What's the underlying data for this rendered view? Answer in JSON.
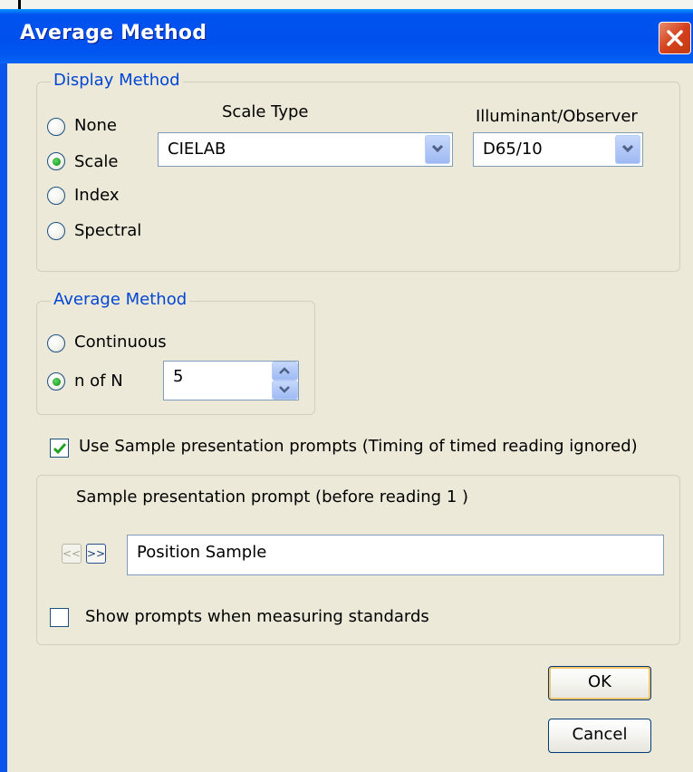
{
  "window": {
    "title": "Average Method"
  },
  "display_method": {
    "legend": "Display Method",
    "options": [
      {
        "label": "None",
        "selected": false
      },
      {
        "label": "Scale",
        "selected": true
      },
      {
        "label": "Index",
        "selected": false
      },
      {
        "label": "Spectral",
        "selected": false
      }
    ],
    "scale_type_label": "Scale Type",
    "scale_type_value": "CIELAB",
    "illuminant_label": "Illuminant/Observer",
    "illuminant_value": "D65/10"
  },
  "average_method": {
    "legend": "Average Method",
    "options": [
      {
        "label": "Continuous",
        "selected": false
      },
      {
        "label": "n of N",
        "selected": true
      }
    ],
    "n_value": "5"
  },
  "prompts": {
    "use_prompts_label": "Use Sample presentation prompts (Timing of timed reading ignored)",
    "use_prompts_checked": true,
    "prompt_caption": "Sample presentation prompt (before reading 1 )",
    "prev_label": "<<",
    "next_label": ">>",
    "prompt_value": "Position Sample",
    "show_standards_label": "Show prompts when measuring standards",
    "show_standards_checked": false
  },
  "buttons": {
    "ok": "OK",
    "cancel": "Cancel"
  },
  "colors": {
    "title_blue": "#0050ee",
    "legend_blue": "#0046d5",
    "dialog_bg": "#ece9d8",
    "close_red": "#d4421c"
  }
}
